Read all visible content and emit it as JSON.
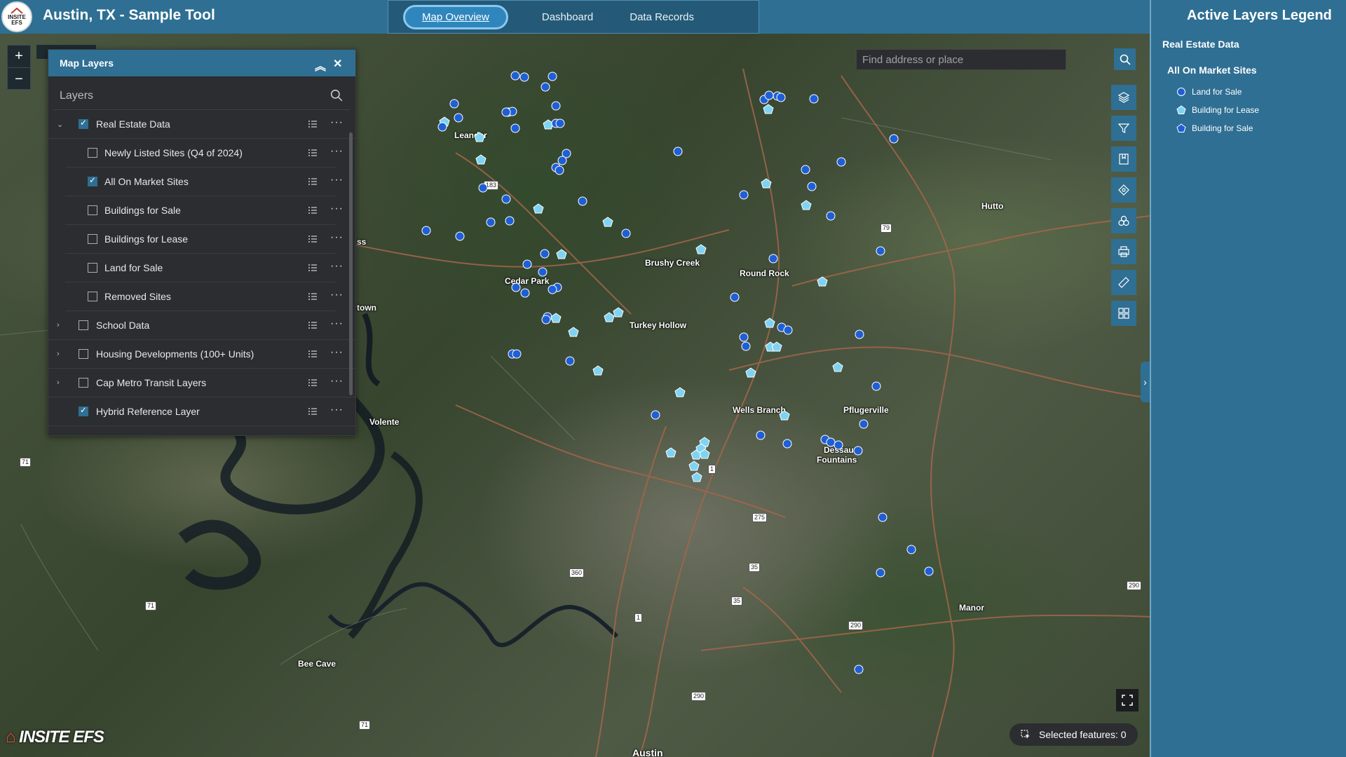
{
  "header": {
    "logo_text": "INSITE EFS",
    "title": "Austin, TX - Sample Tool",
    "tabs": [
      {
        "label": "Map Overview",
        "active": true
      },
      {
        "label": "Dashboard",
        "active": false
      },
      {
        "label": "Data Records",
        "active": false
      }
    ]
  },
  "map": {
    "zoom_in": "+",
    "zoom_out": "−",
    "search_placeholder": "Find address or place",
    "places": {
      "leander": "Leander",
      "brushy_creek": "Brushy Creek",
      "round_rock": "Round Rock",
      "hutto": "Hutto",
      "cedar_park": "Cedar Park",
      "turkey_hollow": "Turkey Hollow",
      "wells_branch": "Wells Branch",
      "pflugerville": "Pflugerville",
      "dessau": "Dessau",
      "fountains": "Fountains",
      "volente": "Volente",
      "manor": "Manor",
      "bee_cave": "Bee Cave",
      "austin": "Austin",
      "ss": "ss",
      "town": "town"
    },
    "shields": {
      "s183": "183",
      "s79": "79",
      "s71a": "71",
      "s71b": "71",
      "s71c": "71",
      "s1a": "1",
      "s1b": "1",
      "s275": "275",
      "s360": "360",
      "s35a": "35",
      "s35b": "35",
      "s290a": "290",
      "s290b": "290",
      "s290c": "290"
    },
    "selected_features": "Selected features: 0",
    "brand": "INSITE EFS"
  },
  "layers_panel": {
    "title": "Map Layers",
    "search_label": "Layers",
    "rows": [
      {
        "label": "Real Estate Data",
        "checked": true,
        "expandable": true,
        "expanded": true,
        "child": false
      },
      {
        "label": "Newly Listed Sites (Q4 of 2024)",
        "checked": false,
        "child": true
      },
      {
        "label": "All On Market Sites",
        "checked": true,
        "child": true
      },
      {
        "label": "Buildings for Sale",
        "checked": false,
        "child": true
      },
      {
        "label": "Buildings for Lease",
        "checked": false,
        "child": true
      },
      {
        "label": "Land for Sale",
        "checked": false,
        "child": true
      },
      {
        "label": "Removed Sites",
        "checked": false,
        "child": true
      },
      {
        "label": "School Data",
        "checked": false,
        "expandable": true,
        "child": false
      },
      {
        "label": "Housing Developments (100+ Units)",
        "checked": false,
        "expandable": true,
        "child": false
      },
      {
        "label": "Cap Metro Transit Layers",
        "checked": false,
        "expandable": true,
        "child": false
      },
      {
        "label": "Hybrid Reference Layer",
        "checked": true,
        "expandable": false,
        "child": false
      }
    ]
  },
  "legend": {
    "title": "Active Layers Legend",
    "layer": "Real Estate Data",
    "group": "All On Market Sites",
    "items": [
      {
        "label": "Land for Sale",
        "symbol": "circle",
        "color": "#1f5fd6"
      },
      {
        "label": "Building for Lease",
        "symbol": "pentagon",
        "color": "#7fd3f2"
      },
      {
        "label": "Building for Sale",
        "symbol": "pentagon",
        "color": "#1f5fd6"
      }
    ]
  },
  "colors": {
    "header_blue": "#2f6f93",
    "land_for_sale": "#1f5fd6",
    "building_for_lease": "#7fd3f2"
  }
}
